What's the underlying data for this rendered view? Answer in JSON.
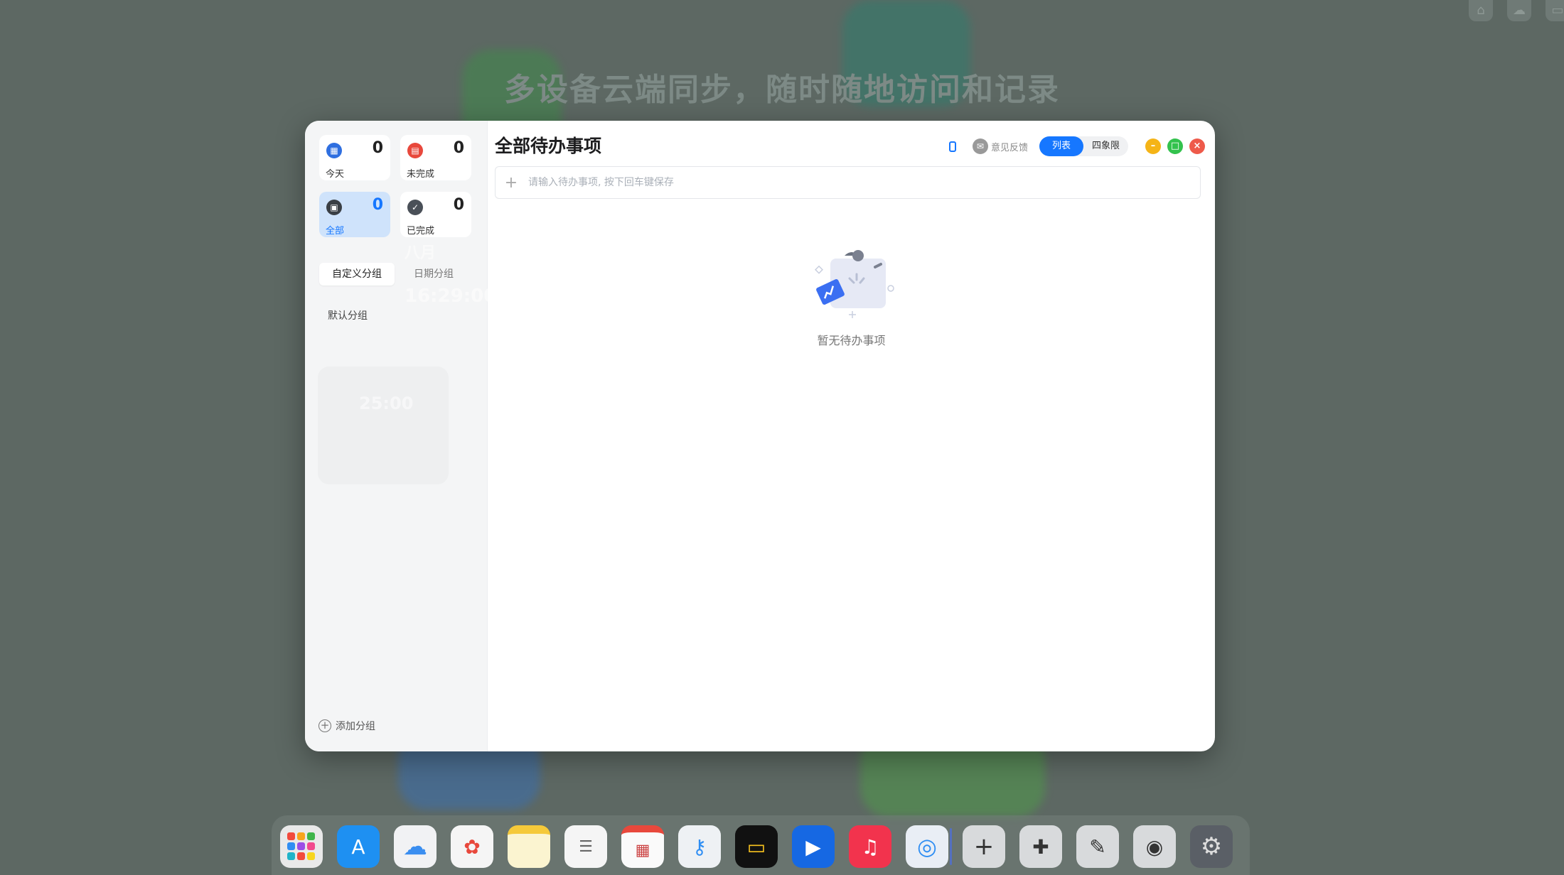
{
  "background": {
    "headline": "多设备云端同步，随时随地访问和记录",
    "ghost": {
      "month": "八月",
      "time": "16:29:00",
      "timer": "25:00"
    }
  },
  "sidebar": {
    "cards": [
      {
        "label": "今天",
        "count": "0",
        "color": "#2f6fe0"
      },
      {
        "label": "未完成",
        "count": "0",
        "color": "#e8483c"
      },
      {
        "label": "全部",
        "count": "0",
        "color": "#3a3f45"
      },
      {
        "label": "已完成",
        "count": "0",
        "color": "#4a5058"
      }
    ],
    "tabs": [
      "自定义分组",
      "日期分组"
    ],
    "groups": [
      "默认分组"
    ],
    "add_group_label": "添加分组"
  },
  "main": {
    "title": "全部待办事项",
    "feedback_label": "意见反馈",
    "view_modes": [
      "列表",
      "四象限"
    ],
    "input_placeholder": "请输入待办事项, 按下回车键保存",
    "empty_text": "暂无待办事项"
  },
  "colors": {
    "accent": "#1677ff",
    "minimize": "#f5b417",
    "maximize": "#33c24d",
    "close": "#ee5a4a"
  },
  "dock": {
    "apps": [
      "launchpad-icon",
      "app-store-icon",
      "icloud-icon",
      "photos-icon",
      "notes-icon",
      "reminders-icon",
      "calendar-icon",
      "keychain-icon",
      "wallet-icon",
      "video-player-icon",
      "music-icon",
      "safari-icon",
      "add-icon",
      "extensions-icon",
      "brush-icon",
      "camera-settings-icon",
      "system-settings-icon"
    ]
  }
}
